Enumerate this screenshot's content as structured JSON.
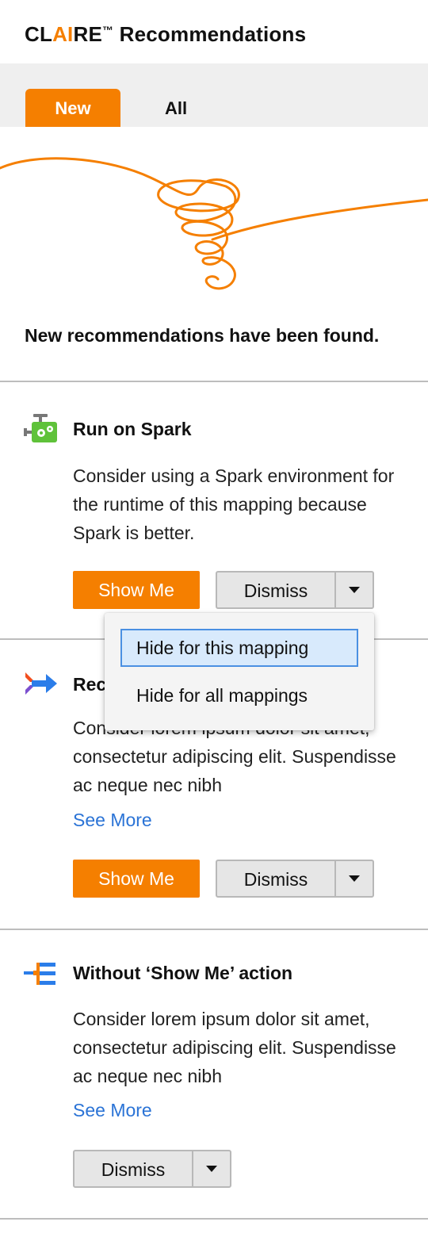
{
  "header": {
    "title_prefix": "CL",
    "title_highlight": "AI",
    "title_suffix": "RE",
    "trademark": "™",
    "title_rest": " Recommendations"
  },
  "tabs": [
    {
      "label": "New",
      "active": true
    },
    {
      "label": "All",
      "active": false
    }
  ],
  "hero": {
    "message": "New recommendations have been found."
  },
  "cards": [
    {
      "icon": "spark-engine-icon",
      "title": "Run on Spark",
      "description": "Consider using a Spark environment for the runtime of this mapping because Spark is better.",
      "show_me_label": "Show Me",
      "dismiss_label": "Dismiss"
    },
    {
      "icon": "merge-arrow-icon",
      "title": "Rec…",
      "description": "Consider lorem ipsum dolor sit amet, consectetur adipiscing elit. Suspendisse ac neque nec nibh",
      "see_more": "See More",
      "show_me_label": "Show Me",
      "dismiss_label": "Dismiss"
    },
    {
      "icon": "hierarchy-icon",
      "title": "Without ‘Show Me’ action",
      "description": "Consider lorem ipsum dolor sit amet, consectetur adipiscing elit. Suspendisse ac neque nec nibh",
      "see_more": "See More",
      "dismiss_label": "Dismiss"
    }
  ],
  "dismiss_menu": {
    "items": [
      {
        "label": "Hide for this mapping",
        "selected": true
      },
      {
        "label": "Hide for all mappings",
        "selected": false
      }
    ]
  },
  "colors": {
    "accent": "#f57f00",
    "link": "#2a73d6",
    "menu_highlight": "#d8eafc"
  }
}
